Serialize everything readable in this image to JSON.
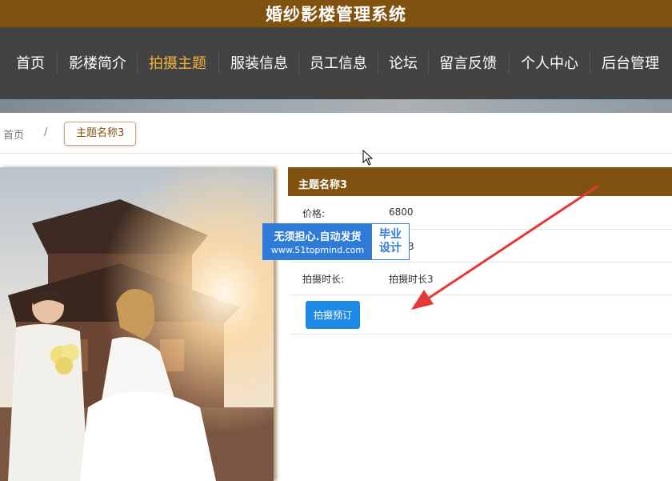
{
  "app": {
    "title": "婚纱影楼管理系统"
  },
  "nav": {
    "items": [
      {
        "label": "首页",
        "active": false
      },
      {
        "label": "影楼简介",
        "active": false
      },
      {
        "label": "拍摄主题",
        "active": true
      },
      {
        "label": "服装信息",
        "active": false
      },
      {
        "label": "员工信息",
        "active": false
      },
      {
        "label": "论坛",
        "active": false
      },
      {
        "label": "留言反馈",
        "active": false
      },
      {
        "label": "个人中心",
        "active": false
      },
      {
        "label": "后台管理",
        "active": false
      }
    ]
  },
  "breadcrumb": {
    "home": "首页",
    "separator": "/",
    "current": "主题名称3"
  },
  "detail": {
    "title": "主题名称3",
    "rows": [
      {
        "label": "价格:",
        "value": "6800"
      },
      {
        "label": "",
        "value": "地点3"
      },
      {
        "label": "拍摄时长:",
        "value": "拍摄时长3"
      }
    ],
    "book_button": "拍摄预订"
  },
  "watermark": {
    "line1": "无须担心.自动发货",
    "line2": "www.51topmind.com",
    "badge1": "毕业",
    "badge2": "设计"
  },
  "colors": {
    "brand": "#80520f",
    "nav_bg": "#434343",
    "nav_active": "#f3b43a",
    "button": "#1e88e5",
    "annotation_arrow": "#e53935"
  }
}
